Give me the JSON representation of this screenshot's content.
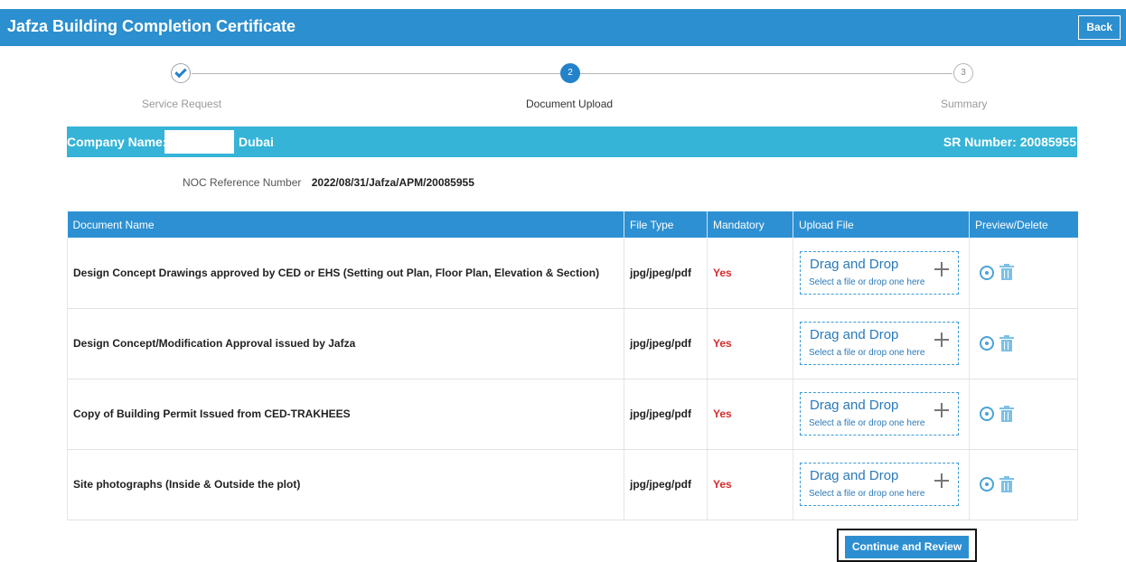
{
  "header": {
    "title": "Jafza Building Completion Certificate",
    "back_label": "Back"
  },
  "stepper": {
    "steps": [
      {
        "label": "Service Request",
        "number": "1",
        "status": "done"
      },
      {
        "label": "Document Upload",
        "number": "2",
        "status": "active"
      },
      {
        "label": "Summary",
        "number": "3",
        "status": "pending"
      }
    ]
  },
  "company": {
    "label": "Company Name:",
    "city": "Dubai",
    "sr_number": "SR Number: 20085955"
  },
  "noc": {
    "label": "NOC Reference Number",
    "value": "2022/08/31/Jafza/APM/20085955"
  },
  "table": {
    "headers": [
      "Document Name",
      "File Type",
      "Mandatory",
      "Upload File",
      "Preview/Delete"
    ],
    "rows": [
      {
        "name": "Design Concept Drawings approved by CED or EHS (Setting out Plan, Floor Plan, Elevation & Section)",
        "file_type": "jpg/jpeg/pdf",
        "mandatory": "Yes"
      },
      {
        "name": "Design Concept/Modification Approval issued by Jafza",
        "file_type": "jpg/jpeg/pdf",
        "mandatory": "Yes"
      },
      {
        "name": "Copy of Building Permit Issued from CED-TRAKHEES",
        "file_type": "jpg/jpeg/pdf",
        "mandatory": "Yes"
      },
      {
        "name": "Site photographs (Inside & Outside the plot)",
        "file_type": "jpg/jpeg/pdf",
        "mandatory": "Yes"
      }
    ],
    "dropzone": {
      "title": "Drag and Drop",
      "subtitle": "Select a file or drop one here"
    }
  },
  "continue_label": "Continue and Review",
  "colors": {
    "brand": "#2c8fcf",
    "company_bar": "#35b4d8",
    "mandatory": "#d42b2b"
  }
}
